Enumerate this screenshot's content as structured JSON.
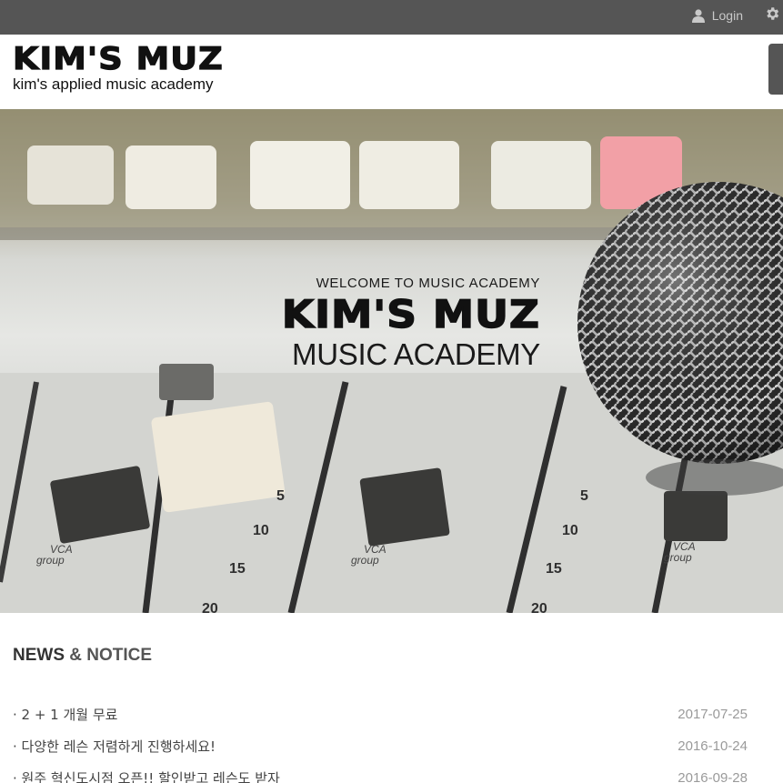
{
  "topbar": {
    "login_label": "Login",
    "icons": [
      "user-icon",
      "gear-icon"
    ]
  },
  "header": {
    "logo_title": "KIM'S MUZ",
    "logo_subtitle": "kim's applied music academy"
  },
  "hero": {
    "welcome": "WELCOME TO MUSIC ACADEMY",
    "brand": "KIM'S MUZ",
    "academy": "MUSIC ACADEMY"
  },
  "news": {
    "heading_bold": "NEWS",
    "heading_rest": "& NOTICE",
    "items": [
      {
        "title": "· 2 + 1 개월 무료",
        "date": "2017-07-25"
      },
      {
        "title": "· 다양한 레슨 저렴하게 진행하세요!",
        "date": "2016-10-24"
      },
      {
        "title": "· 원주 혁신도시점 오픈!! 할인받고 레슨도 받자",
        "date": "2016-09-28"
      }
    ]
  },
  "colors": {
    "topbar": "#555555",
    "text_dark": "#111111",
    "date": "#9a9a9a"
  }
}
